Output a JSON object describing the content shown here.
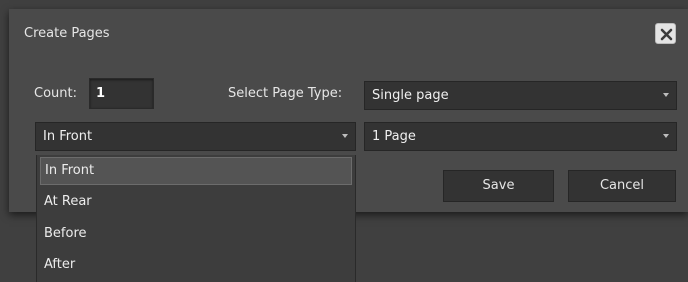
{
  "dialog": {
    "title": "Create Pages",
    "close_icon": "close-x-icon"
  },
  "form": {
    "count_label": "Count:",
    "count_value": "1",
    "page_type_label": "Select Page Type:",
    "page_type_selected": "Single page",
    "position_selected": "In Front",
    "pages_selected": "1 Page"
  },
  "position_dropdown": {
    "options": [
      "In Front",
      "At Rear",
      "Before",
      "After"
    ],
    "highlighted": "In Front"
  },
  "buttons": {
    "save_label": "Save",
    "cancel_label": "Cancel"
  },
  "colors": {
    "dialog_bg": "#4a4a4a",
    "field_bg": "#333333",
    "backdrop": "#404040"
  }
}
